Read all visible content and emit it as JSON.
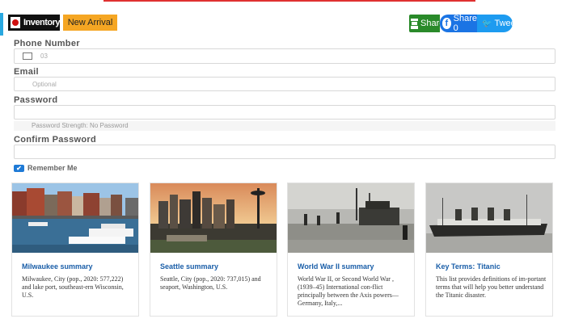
{
  "header": {
    "inventory_label": "Inventory",
    "new_arrival_label": "New Arrival"
  },
  "share": {
    "email_label": "Share",
    "facebook_label": "Share 0",
    "twitter_label": "Tweet"
  },
  "form": {
    "phone": {
      "label": "Phone Number",
      "value": "03"
    },
    "email": {
      "label": "Email",
      "placeholder": "Optional"
    },
    "password": {
      "label": "Password",
      "strength_text": "Password Strength: No Password"
    },
    "confirm": {
      "label": "Confirm Password"
    },
    "remember": {
      "label": "Remember Me",
      "checked": true
    }
  },
  "cards": [
    {
      "title": "Milwaukee summary",
      "description": "Milwaukee, City (pop., 2020: 577,222) and lake port, southeast-ern Wisconsin, U.S."
    },
    {
      "title": "Seattle summary",
      "description": "Seattle, City (pop., 2020: 737,015) and seaport, Washington, U.S."
    },
    {
      "title": "World War II summary",
      "description": "World War II, or Second World War , (1939–45) International con-flict principally between the Axis powers—Germany, Italy,..."
    },
    {
      "title": "Key Terms: Titanic",
      "description": "This list provides definitions of im-portant terms that will help you better understand the Titanic disaster."
    }
  ],
  "colors": {
    "accent_blue": "#29a8e0",
    "link_blue": "#1a5ea8",
    "arrival_orange": "#f5a623",
    "email_green": "#2a8a2a",
    "facebook_blue": "#1b74e4",
    "twitter_blue": "#1d9bf0"
  }
}
